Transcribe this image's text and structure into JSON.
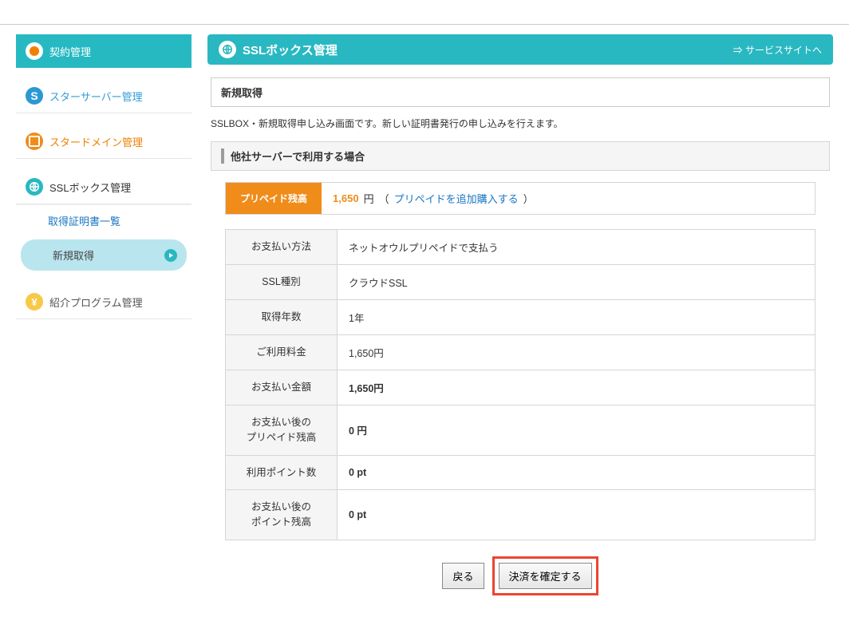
{
  "sidebar": {
    "contract": "契約管理",
    "starserver": "スターサーバー管理",
    "stardomain": "スタードメイン管理",
    "sslbox": "SSLボックス管理",
    "sub_cert_list": "取得証明書一覧",
    "sub_new": "新規取得",
    "referral": "紹介プログラム管理"
  },
  "header": {
    "title": "SSLボックス管理",
    "service_link": "⇒ サービスサイトへ"
  },
  "content": {
    "box_title": "新規取得",
    "description": "SSLBOX・新規取得申し込み画面です。新しい証明書発行の申し込みを行えます。",
    "section_title": "他社サーバーで利用する場合"
  },
  "prepaid": {
    "label": "プリペイド残高",
    "amount": "1,650",
    "unit": "円",
    "link_paren_l": "（",
    "link_text": "プリペイドを追加購入する",
    "link_paren_r": "）"
  },
  "rows": {
    "pay_method_h": "お支払い方法",
    "pay_method_v": "ネットオウルプリペイドで支払う",
    "ssl_type_h": "SSL種別",
    "ssl_type_v": "クラウドSSL",
    "years_h": "取得年数",
    "years_v": "1年",
    "fee_h": "ご利用料金",
    "fee_v": "1,650円",
    "pay_amount_h": "お支払い金額",
    "pay_amount_v": "1,650円",
    "after_prepaid_h": "お支払い後の\nプリペイド残高",
    "after_prepaid_v": "0 円",
    "use_points_h": "利用ポイント数",
    "use_points_v": "0 pt",
    "after_points_h": "お支払い後の\nポイント残高",
    "after_points_v": "0 pt"
  },
  "buttons": {
    "back": "戻る",
    "confirm": "決済を確定する"
  }
}
